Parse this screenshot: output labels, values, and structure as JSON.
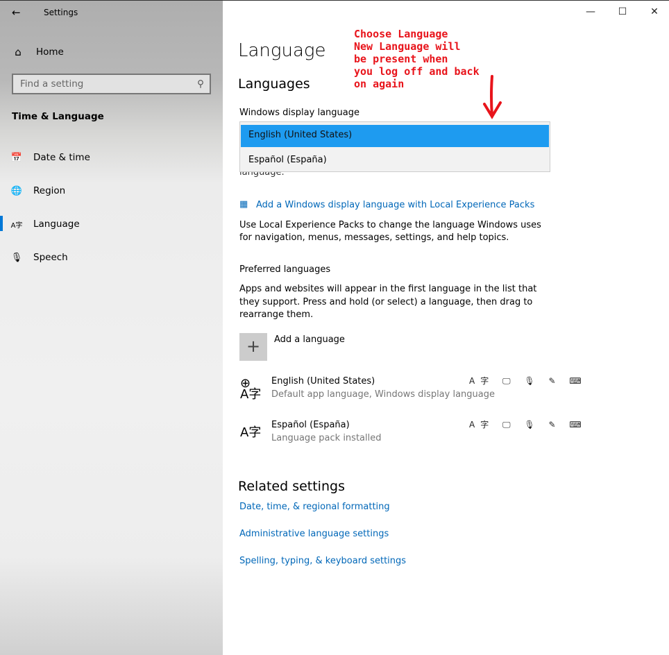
{
  "window": {
    "title": "Settings",
    "minimize": "—",
    "maximize": "☐",
    "close": "✕"
  },
  "sidebar": {
    "back": "←",
    "home": "Home",
    "search_placeholder": "Find a setting",
    "section": "Time & Language",
    "items": [
      {
        "label": "Date & time",
        "icon": "calendar-clock-icon",
        "glyph": "📅"
      },
      {
        "label": "Region",
        "icon": "globe-icon",
        "glyph": "🌐"
      },
      {
        "label": "Language",
        "icon": "language-icon",
        "glyph": "A字"
      },
      {
        "label": "Speech",
        "icon": "microphone-icon",
        "glyph": "🎙"
      }
    ]
  },
  "main": {
    "title": "Language",
    "subtitle": "Languages",
    "display_label": "Windows display language",
    "dropdown": {
      "options": [
        "English (United States)",
        "Español (España)"
      ],
      "selected": "English (United States)"
    },
    "hidden_fragment": "language.",
    "lxp_link": "Add a Windows display language with Local Experience Packs",
    "lxp_desc": "Use Local Experience Packs to change the language Windows uses for navigation, menus, messages, settings, and help topics.",
    "preferred_label": "Preferred languages",
    "preferred_desc": "Apps and websites will appear in the first language in the list that they support. Press and hold (or select) a language, then drag to rearrange them.",
    "add_language": "Add a language",
    "languages": [
      {
        "name": "English (United States)",
        "status": "Default app language, Windows display language"
      },
      {
        "name": "Español (España)",
        "status": "Language pack installed"
      }
    ],
    "feature_icons": "A字 🖵 🎙 ✎ ⌨",
    "related_title": "Related settings",
    "related_links": [
      "Date, time, & regional formatting",
      "Administrative language settings",
      "Spelling, typing, & keyboard settings"
    ]
  },
  "annotation": {
    "text": [
      "Choose Language",
      "New Language will",
      "be present when",
      "you log off and back",
      "on again"
    ],
    "color": "#e8141b"
  },
  "colors": {
    "accent": "#0078d7",
    "link": "#0067b8",
    "selected": "#1e9bf0"
  }
}
